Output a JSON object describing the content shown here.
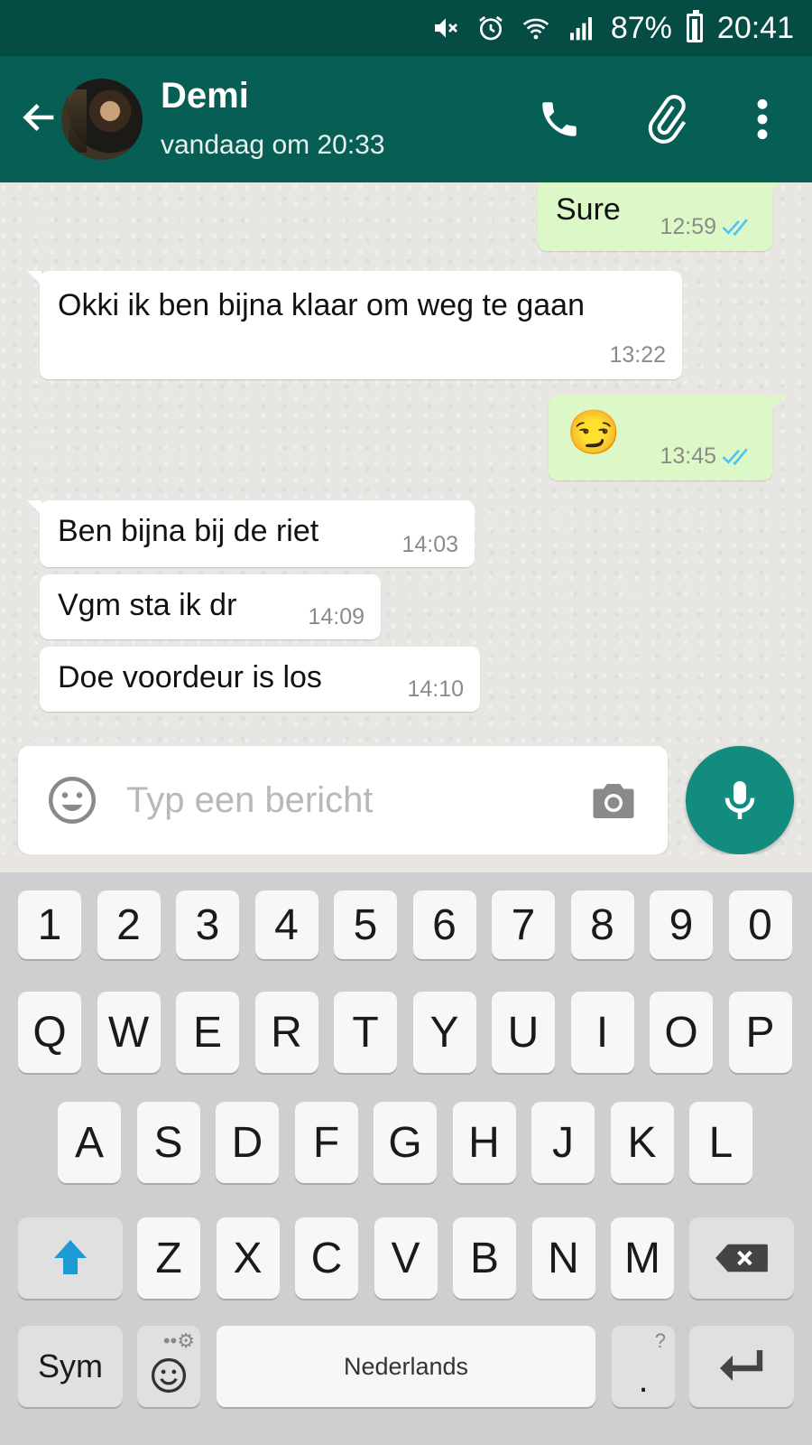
{
  "status_bar": {
    "battery": "87%",
    "time": "20:41",
    "icons": [
      "mute-icon",
      "alarm-icon",
      "wifi-icon",
      "signal-icon",
      "battery-icon"
    ]
  },
  "toolbar": {
    "contact_name": "Demi",
    "last_seen": "vandaag om 20:33",
    "icons": [
      "back-arrow-icon",
      "phone-icon",
      "paperclip-icon",
      "more-vert-icon"
    ]
  },
  "messages": [
    {
      "dir": "out",
      "text": "Sure",
      "time": "12:59",
      "read": true
    },
    {
      "dir": "in",
      "text": "Okki ik ben bijna klaar om weg te gaan",
      "time": "13:22"
    },
    {
      "dir": "out",
      "text": "😏",
      "time": "13:45",
      "read": true
    },
    {
      "dir": "in",
      "text": "Ben bijna bij de riet",
      "time": "14:03"
    },
    {
      "dir": "in",
      "text": "Vgm sta ik dr",
      "time": "14:09"
    },
    {
      "dir": "in",
      "text": "Doe voordeur is los",
      "time": "14:10"
    }
  ],
  "composer": {
    "placeholder": "Typ een bericht",
    "value": ""
  },
  "keyboard": {
    "row_numbers": [
      "1",
      "2",
      "3",
      "4",
      "5",
      "6",
      "7",
      "8",
      "9",
      "0"
    ],
    "row1": [
      "Q",
      "W",
      "E",
      "R",
      "T",
      "Y",
      "U",
      "I",
      "O",
      "P"
    ],
    "row2": [
      "A",
      "S",
      "D",
      "F",
      "G",
      "H",
      "J",
      "K",
      "L"
    ],
    "row3": [
      "Z",
      "X",
      "C",
      "V",
      "B",
      "N",
      "M"
    ],
    "sym_label": "Sym",
    "space_label": "Nederlands",
    "period_hint": "?",
    "period_label": "."
  },
  "colors": {
    "status_bar": "#054d44",
    "toolbar": "#075e54",
    "accent": "#128c7e",
    "outgoing_bubble": "#dcf8c6",
    "incoming_bubble": "#ffffff",
    "read_ticks": "#4fc3f7",
    "shift_arrow": "#1e9ad6"
  }
}
